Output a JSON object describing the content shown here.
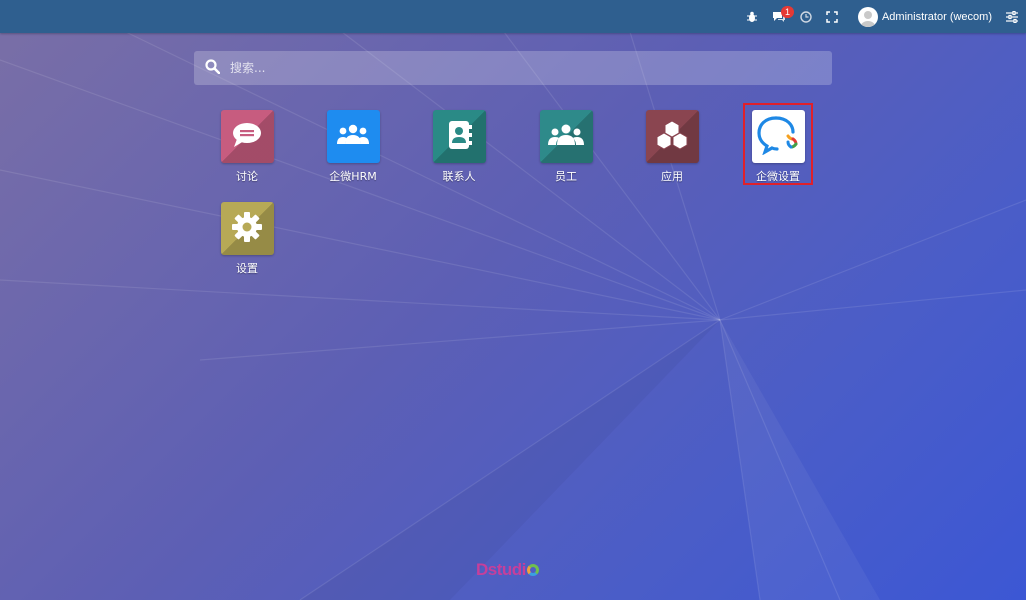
{
  "topbar": {
    "notification_count": "1",
    "user_name": "Administrator (wecom)",
    "icons": [
      "bug-icon",
      "chat-icon",
      "clock-icon",
      "fullscreen-icon",
      "user-avatar",
      "settings-sliders-icon"
    ]
  },
  "search": {
    "placeholder": "搜索..."
  },
  "apps": [
    {
      "label": "讨论",
      "icon": "chat-bubble-icon",
      "color": "#c75c7f"
    },
    {
      "label": "企微HRM",
      "icon": "users-group-icon",
      "color": "#1e8cf0"
    },
    {
      "label": "联系人",
      "icon": "address-book-icon",
      "color": "#2a8a86"
    },
    {
      "label": "员工",
      "icon": "employees-icon",
      "color": "#2e8a8a"
    },
    {
      "label": "应用",
      "icon": "cubes-icon",
      "color": "#8a4550"
    },
    {
      "label": "企微设置",
      "icon": "wecom-icon",
      "color": "#ffffff"
    },
    {
      "label": "设置",
      "icon": "gear-icon",
      "color": "#b7a956"
    }
  ],
  "footer": {
    "brand": "Dstudi"
  }
}
